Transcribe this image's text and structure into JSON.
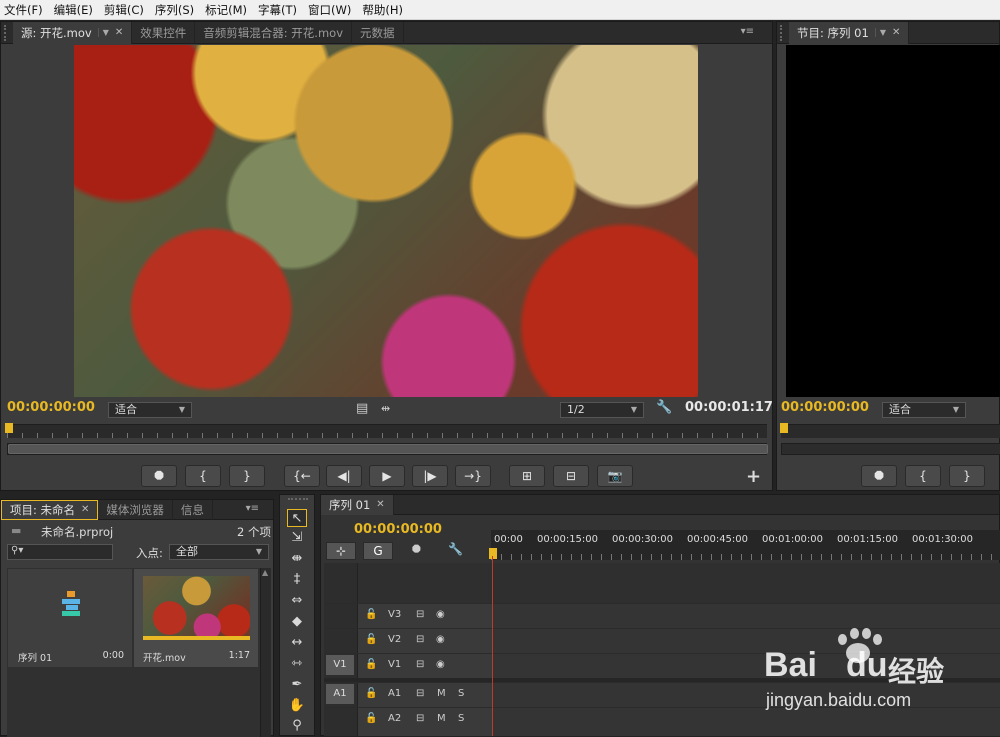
{
  "menu": [
    "文件(F)",
    "编辑(E)",
    "剪辑(C)",
    "序列(S)",
    "标记(M)",
    "字幕(T)",
    "窗口(W)",
    "帮助(H)"
  ],
  "source_panel": {
    "tabs": [
      {
        "label": "源: 开花.mov"
      },
      {
        "label": "效果控件"
      },
      {
        "label": "音频剪辑混合器: 开花.mov"
      },
      {
        "label": "元数据"
      }
    ],
    "timecode": "00:00:00:00",
    "fit": "适合",
    "resolution": "1/2",
    "duration": "00:00:01:17"
  },
  "program_panel": {
    "tab": "节目: 序列 01",
    "timecode": "00:00:00:00",
    "fit": "适合"
  },
  "transport_icons": [
    "marker-icon",
    "mark-in-icon",
    "mark-out-icon",
    "go-to-in-icon",
    "step-back-icon",
    "play-icon",
    "step-forward-icon",
    "go-to-out-icon",
    "insert-icon",
    "overwrite-icon",
    "camera-icon"
  ],
  "transport_glyphs": {
    "marker": "⯃",
    "in": "{",
    "out": "}",
    "goin": "{←",
    "back": "◀|",
    "play": "▶",
    "fwd": "|▶",
    "goout": "→}",
    "insert": "⊞",
    "overwrite": "⊟",
    "camera": "📷",
    "add": "+"
  },
  "project_panel": {
    "tabs": [
      {
        "label": "项目: 未命名"
      },
      {
        "label": "媒体浏览器"
      },
      {
        "label": "信息"
      }
    ],
    "project_file": "未命名.prproj",
    "item_count": "2 个项",
    "in_point_label": "入点:",
    "in_point_value": "全部",
    "items": [
      {
        "name": "序列 01",
        "duration": "0:00"
      },
      {
        "name": "开花.mov",
        "duration": "1:17"
      }
    ]
  },
  "timeline": {
    "tab": "序列 01",
    "timecode": "00:00:00:00",
    "ruler_labels": [
      "00:00",
      "00:00:15:00",
      "00:00:30:00",
      "00:00:45:00",
      "00:01:00:00",
      "00:01:15:00",
      "00:01:30:00"
    ],
    "video_tracks": [
      "V3",
      "V2",
      "V1"
    ],
    "audio_tracks": [
      "A1",
      "A2"
    ],
    "source_patch_v": "V1",
    "source_patch_a": "A1",
    "mute_label": "M",
    "solo_label": "S"
  },
  "watermark": {
    "brand": "Bai",
    "brand2": "du",
    "brand_cn": "经验",
    "url": "jingyan.baidu.com"
  },
  "colors": {
    "timecode": "#e8b923",
    "playhead": "#c0392b",
    "panel_bg": "#3c3c3c"
  }
}
